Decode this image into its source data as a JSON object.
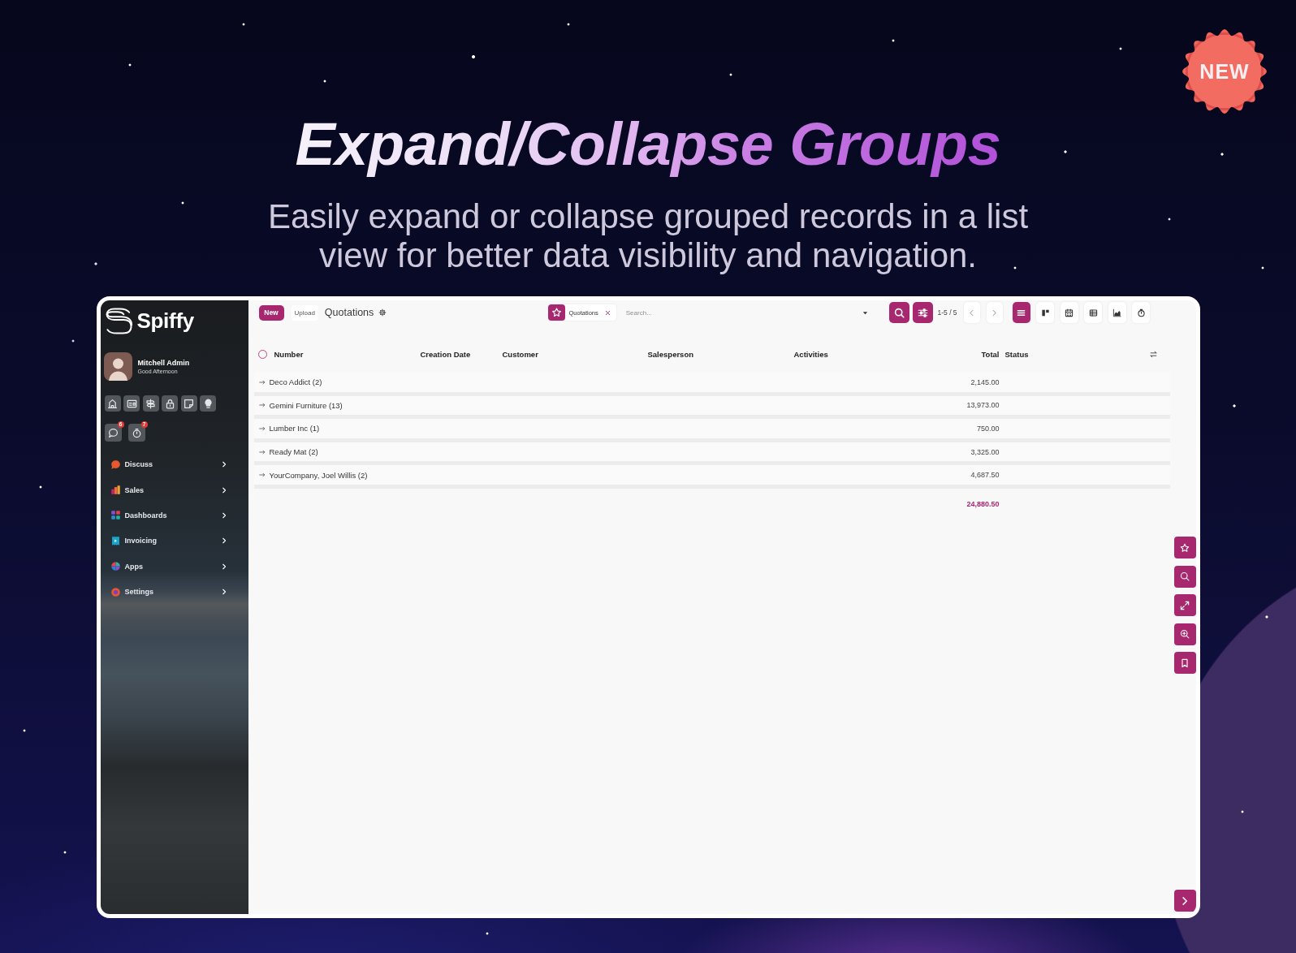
{
  "banner": {
    "title": "Expand/Collapse Groups",
    "subtitle": "Easily expand or collapse grouped records in a list view for better data visibility and navigation.",
    "badge": "NEW"
  },
  "sidebar": {
    "brand": "Spiffy",
    "user": {
      "name": "Mitchell Admin",
      "greeting": "Good Afternoon"
    },
    "notifications": [
      {
        "kind": "messages",
        "count": "6"
      },
      {
        "kind": "activities",
        "count": "7"
      }
    ],
    "menu": [
      {
        "label": "Discuss",
        "kind": "discuss"
      },
      {
        "label": "Sales",
        "kind": "sales"
      },
      {
        "label": "Dashboards",
        "kind": "dashboards"
      },
      {
        "label": "Invoicing",
        "kind": "invoicing"
      },
      {
        "label": "Apps",
        "kind": "apps"
      },
      {
        "label": "Settings",
        "kind": "settings"
      }
    ]
  },
  "toolbar": {
    "buttons": [
      {
        "label": "New",
        "kind": "primary"
      },
      {
        "label": "Upload",
        "kind": "secondary"
      }
    ],
    "title": "Quotations",
    "search": {
      "facets": [
        {
          "label": "Quotations"
        }
      ],
      "placeholder": "Search..."
    },
    "pager": "1-5 / 5",
    "views": [
      {
        "kind": "list",
        "selected": true
      },
      {
        "kind": "kanban",
        "selected": false
      },
      {
        "kind": "calendar",
        "selected": false
      },
      {
        "kind": "pivot",
        "selected": false
      },
      {
        "kind": "graph",
        "selected": false
      },
      {
        "kind": "activity",
        "selected": false
      }
    ]
  },
  "table": {
    "select_all": {
      "checked": false
    },
    "columns": [
      {
        "label": "Number",
        "kind": "text"
      },
      {
        "label": "Creation Date",
        "kind": "text"
      },
      {
        "label": "Customer",
        "kind": "text"
      },
      {
        "label": "Salesperson",
        "kind": "text"
      },
      {
        "label": "Activities",
        "kind": "text"
      },
      {
        "label": "Total",
        "kind": "number"
      },
      {
        "label": "Status",
        "kind": "text"
      }
    ],
    "groups": [
      {
        "label": "Deco Addict (2)",
        "total": "2,145.00",
        "expanded": false
      },
      {
        "label": "Gemini Furniture (13)",
        "total": "13,973.00",
        "expanded": false
      },
      {
        "label": "Lumber Inc (1)",
        "total": "750.00",
        "expanded": false
      },
      {
        "label": "Ready Mat (2)",
        "total": "3,325.00",
        "expanded": false
      },
      {
        "label": "YourCompany, Joel Willis (2)",
        "total": "4,687.50",
        "expanded": false
      }
    ],
    "grand_total": "24,880.50"
  }
}
